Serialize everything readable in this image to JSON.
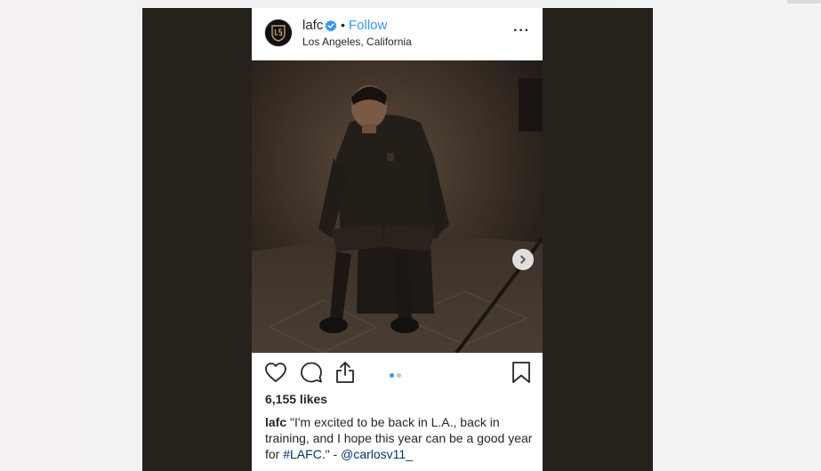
{
  "colors": {
    "frame_bg": "#27211c",
    "follow_blue": "#3897f0",
    "verified_blue": "#3897f0",
    "text": "#262626",
    "link": "#003569"
  },
  "post": {
    "username": "lafc",
    "separator": "•",
    "follow_label": "Follow",
    "location": "Los Angeles, California",
    "more_label": "···",
    "verified_icon": "verified-badge-icon",
    "carousel": {
      "current": 1,
      "total": 2
    },
    "likes": "6,155 likes",
    "caption": {
      "user": "lafc",
      "text": " \"I'm excited to be back in L.A., back in training, and I hope this year can be a good year for ",
      "hashtag": "#LAFC",
      "middle": ".\" - ",
      "mention": "@carlosv11_"
    }
  }
}
